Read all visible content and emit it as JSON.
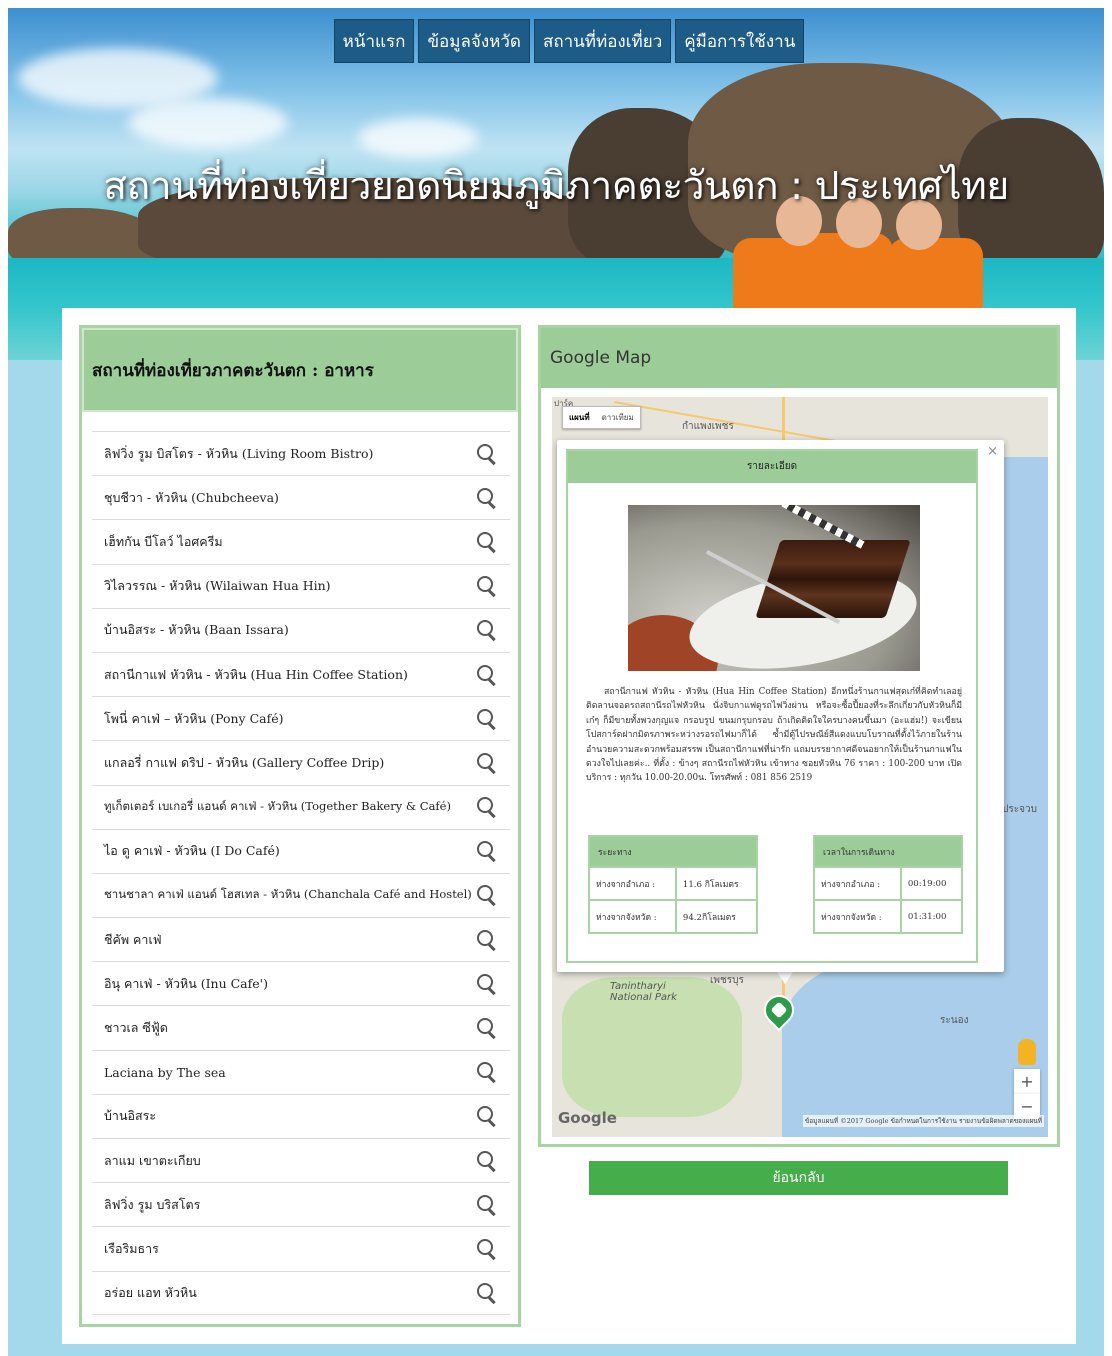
{
  "nav": {
    "items": [
      "หน้าแรก",
      "ข้อมูลจังหวัด",
      "สถานที่ท่องเที่ยว",
      "คู่มือการใช้งาน"
    ]
  },
  "hero": {
    "title": "สถานที่ท่องเที่ยวยอดนิยมภูมิภาคตะวันตก : ประเทศไทย"
  },
  "left_panel": {
    "title": "สถานที่ท่องเที่ยวภาคตะวันตก : อาหาร",
    "items": [
      "ลิฟวิ่ง รูม บิสโตร - หัวหิน (Living Room Bistro)",
      "ชุบชีวา - หัวหิน (Chubcheeva)",
      "เฮ็ทกัน บีโลว์ ไอศครีม",
      "วิไลวรรณ - หัวหิน (Wilaiwan Hua Hin)",
      "บ้านอิสระ - หัวหิน (Baan Issara)",
      "สถานีกาแฟ หัวหิน - หัวหิน (Hua Hin Coffee Station)",
      "โพนี่ คาเฟ่ – หัวหิน (Pony Café)",
      "แกลอรี่ กาแฟ ดริป - หัวหิน (Gallery Coffee Drip)",
      "ทูเก็ตเตอร์ เบเกอรี่ แอนด์ คาเฟ่ - หัวหิน (Together Bakery & Café)",
      "ไอ ดู คาเฟ่ - หัวหิน (I Do Café)",
      "ชานชาลา คาเฟ่ แอนด์ โฮสเทล - หัวหิน (Chanchala Café and Hostel)",
      "ชีคัพ คาเฟ่",
      "อินุ คาเฟ่ - หัวหิน (Inu Cafe')",
      "ชาวเล ซีฟู้ด",
      "Laciana by The sea",
      "บ้านอิสระ",
      "ลาแม เขาตะเกียบ",
      "ลิฟวิ่ง รูม บริสโตร",
      "เรือริมธาร",
      "อร่อย แอท หัวหิน"
    ]
  },
  "right_panel": {
    "title": "Google Map",
    "map": {
      "type_tabs": [
        "แผนที่",
        "ดาวเทียม"
      ],
      "labels": [
        "ปาร์ค",
        "กำแพงเพชร",
        "ประจวบ",
        "Tanintharyi National Park",
        "ระนอง",
        "เพชรบุร"
      ],
      "google": "Google",
      "credit": "ข้อมูลแผนที่ ©2017 Google   ข้อกำหนดในการใช้งาน   รายงานข้อผิดพลาดของแผนที่",
      "zoom_in": "+",
      "zoom_out": "−"
    },
    "info": {
      "close": "×",
      "title": "รายละเอียด",
      "description": "สถานีกาแฟ หัวหิน - หัวหิน (Hua Hin Coffee Station) อีกหนึ่งร้านกาแฟสุดเก๋ที่คิดทำเลอยู่ติดลานจอดรถสถานีรถไฟหัวหิน นั่งจิบกาแฟดูรถไฟวิ่งผ่าน หรือจะซื้อปี้ยองที่ระลึกเกี่ยวกับหัวหินก็มีเก๋ๆ ก็มีขายทั้งพวงกุญแจ กรอบรูป ขนมกรุบกรอบ ถ้าเกิดติดใจใครบางคนขึ้นมา (อะแฮ่ม!) จะเขียนโปสการ์ดฝากมิตรภาพระหว่างรอรถไฟมาก็ได้ ซ้ำมีตู้ไปรษณีย์สีแดงแบบโบราณที่ตั้งไว้ภายในร้านอำนวยความสะดวกพร้อมสรรพ เป็นสถานีกาแฟที่น่ารัก แถมบรรยากาศดีจนอยากให้เป็นร้านกาแฟในดวงใจไปเลยค่ะ.. ที่ตั้ง : ข้างๆ สถานีรถไฟหัวหิน เข้าทาง ซอยหัวหิน 76 ราคา : 100-200 บาท เปิดบริการ : ทุกวัน 10.00-20.00น. โทรศัพท์ : 081 856 2519",
      "distance": {
        "header": "ระยะทาง",
        "rows": [
          {
            "label": "ห่างจากอำเภอ :",
            "value": "11.6 กิโลเมตร"
          },
          {
            "label": "ห่างจากจังหวัด :",
            "value": "94.2กิโลเมตร"
          }
        ]
      },
      "time": {
        "header": "เวลาในการเดินทาง",
        "rows": [
          {
            "label": "ห่างจากอำเภอ :",
            "value": "00:19:00"
          },
          {
            "label": "ห่างจากจังหวัด :",
            "value": "01:31:00"
          }
        ]
      }
    },
    "back_label": "ย้อนกลับ"
  }
}
